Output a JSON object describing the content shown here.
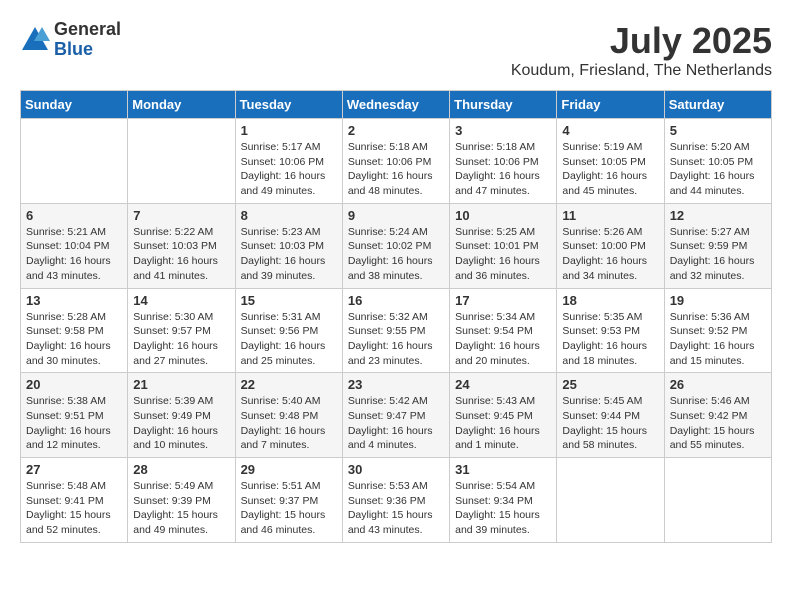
{
  "header": {
    "logo_general": "General",
    "logo_blue": "Blue",
    "month_year": "July 2025",
    "location": "Koudum, Friesland, The Netherlands"
  },
  "weekdays": [
    "Sunday",
    "Monday",
    "Tuesday",
    "Wednesday",
    "Thursday",
    "Friday",
    "Saturday"
  ],
  "weeks": [
    [
      {
        "day": "",
        "info": ""
      },
      {
        "day": "",
        "info": ""
      },
      {
        "day": "1",
        "info": "Sunrise: 5:17 AM\nSunset: 10:06 PM\nDaylight: 16 hours\nand 49 minutes."
      },
      {
        "day": "2",
        "info": "Sunrise: 5:18 AM\nSunset: 10:06 PM\nDaylight: 16 hours\nand 48 minutes."
      },
      {
        "day": "3",
        "info": "Sunrise: 5:18 AM\nSunset: 10:06 PM\nDaylight: 16 hours\nand 47 minutes."
      },
      {
        "day": "4",
        "info": "Sunrise: 5:19 AM\nSunset: 10:05 PM\nDaylight: 16 hours\nand 45 minutes."
      },
      {
        "day": "5",
        "info": "Sunrise: 5:20 AM\nSunset: 10:05 PM\nDaylight: 16 hours\nand 44 minutes."
      }
    ],
    [
      {
        "day": "6",
        "info": "Sunrise: 5:21 AM\nSunset: 10:04 PM\nDaylight: 16 hours\nand 43 minutes."
      },
      {
        "day": "7",
        "info": "Sunrise: 5:22 AM\nSunset: 10:03 PM\nDaylight: 16 hours\nand 41 minutes."
      },
      {
        "day": "8",
        "info": "Sunrise: 5:23 AM\nSunset: 10:03 PM\nDaylight: 16 hours\nand 39 minutes."
      },
      {
        "day": "9",
        "info": "Sunrise: 5:24 AM\nSunset: 10:02 PM\nDaylight: 16 hours\nand 38 minutes."
      },
      {
        "day": "10",
        "info": "Sunrise: 5:25 AM\nSunset: 10:01 PM\nDaylight: 16 hours\nand 36 minutes."
      },
      {
        "day": "11",
        "info": "Sunrise: 5:26 AM\nSunset: 10:00 PM\nDaylight: 16 hours\nand 34 minutes."
      },
      {
        "day": "12",
        "info": "Sunrise: 5:27 AM\nSunset: 9:59 PM\nDaylight: 16 hours\nand 32 minutes."
      }
    ],
    [
      {
        "day": "13",
        "info": "Sunrise: 5:28 AM\nSunset: 9:58 PM\nDaylight: 16 hours\nand 30 minutes."
      },
      {
        "day": "14",
        "info": "Sunrise: 5:30 AM\nSunset: 9:57 PM\nDaylight: 16 hours\nand 27 minutes."
      },
      {
        "day": "15",
        "info": "Sunrise: 5:31 AM\nSunset: 9:56 PM\nDaylight: 16 hours\nand 25 minutes."
      },
      {
        "day": "16",
        "info": "Sunrise: 5:32 AM\nSunset: 9:55 PM\nDaylight: 16 hours\nand 23 minutes."
      },
      {
        "day": "17",
        "info": "Sunrise: 5:34 AM\nSunset: 9:54 PM\nDaylight: 16 hours\nand 20 minutes."
      },
      {
        "day": "18",
        "info": "Sunrise: 5:35 AM\nSunset: 9:53 PM\nDaylight: 16 hours\nand 18 minutes."
      },
      {
        "day": "19",
        "info": "Sunrise: 5:36 AM\nSunset: 9:52 PM\nDaylight: 16 hours\nand 15 minutes."
      }
    ],
    [
      {
        "day": "20",
        "info": "Sunrise: 5:38 AM\nSunset: 9:51 PM\nDaylight: 16 hours\nand 12 minutes."
      },
      {
        "day": "21",
        "info": "Sunrise: 5:39 AM\nSunset: 9:49 PM\nDaylight: 16 hours\nand 10 minutes."
      },
      {
        "day": "22",
        "info": "Sunrise: 5:40 AM\nSunset: 9:48 PM\nDaylight: 16 hours\nand 7 minutes."
      },
      {
        "day": "23",
        "info": "Sunrise: 5:42 AM\nSunset: 9:47 PM\nDaylight: 16 hours\nand 4 minutes."
      },
      {
        "day": "24",
        "info": "Sunrise: 5:43 AM\nSunset: 9:45 PM\nDaylight: 16 hours\nand 1 minute."
      },
      {
        "day": "25",
        "info": "Sunrise: 5:45 AM\nSunset: 9:44 PM\nDaylight: 15 hours\nand 58 minutes."
      },
      {
        "day": "26",
        "info": "Sunrise: 5:46 AM\nSunset: 9:42 PM\nDaylight: 15 hours\nand 55 minutes."
      }
    ],
    [
      {
        "day": "27",
        "info": "Sunrise: 5:48 AM\nSunset: 9:41 PM\nDaylight: 15 hours\nand 52 minutes."
      },
      {
        "day": "28",
        "info": "Sunrise: 5:49 AM\nSunset: 9:39 PM\nDaylight: 15 hours\nand 49 minutes."
      },
      {
        "day": "29",
        "info": "Sunrise: 5:51 AM\nSunset: 9:37 PM\nDaylight: 15 hours\nand 46 minutes."
      },
      {
        "day": "30",
        "info": "Sunrise: 5:53 AM\nSunset: 9:36 PM\nDaylight: 15 hours\nand 43 minutes."
      },
      {
        "day": "31",
        "info": "Sunrise: 5:54 AM\nSunset: 9:34 PM\nDaylight: 15 hours\nand 39 minutes."
      },
      {
        "day": "",
        "info": ""
      },
      {
        "day": "",
        "info": ""
      }
    ]
  ]
}
